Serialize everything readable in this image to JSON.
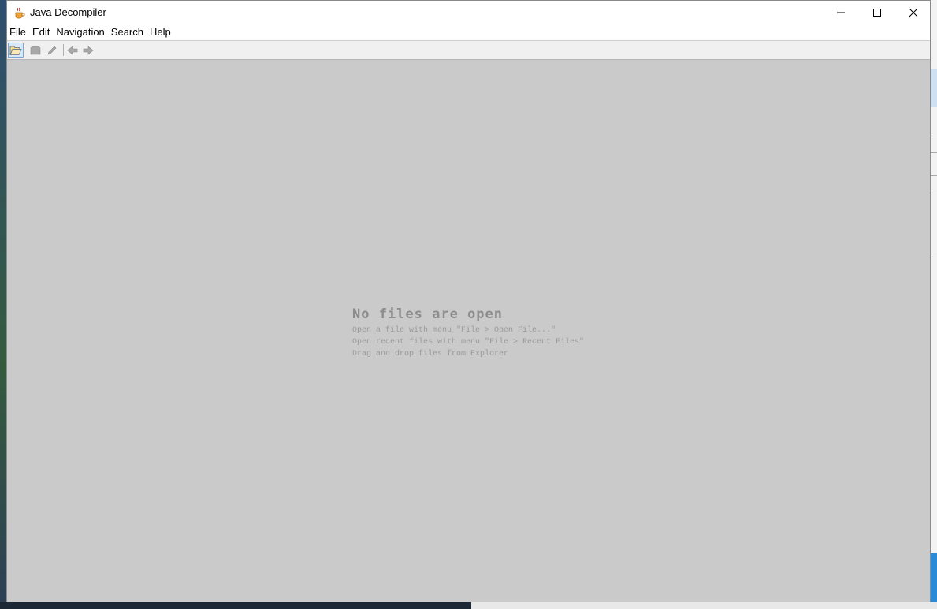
{
  "window": {
    "title": "Java Decompiler"
  },
  "menu": {
    "items": [
      "File",
      "Edit",
      "Navigation",
      "Search",
      "Help"
    ]
  },
  "toolbar": {
    "buttons": [
      {
        "icon": "open-folder-icon"
      },
      {
        "icon": "close-file-icon"
      },
      {
        "icon": "save-icon"
      },
      {
        "icon": "back-arrow-icon"
      },
      {
        "icon": "forward-arrow-icon"
      }
    ]
  },
  "content": {
    "empty_title": "No files are open",
    "hint_open": "Open a file with menu \"File > Open File...\"",
    "hint_recent": "Open recent files with menu \"File > Recent Files\"",
    "hint_drag": "Drag and drop files from Explorer"
  },
  "colors": {
    "content_bg": "#cacaca",
    "hint_text": "#8c8c8c",
    "titlebar_bg": "#ffffff"
  }
}
